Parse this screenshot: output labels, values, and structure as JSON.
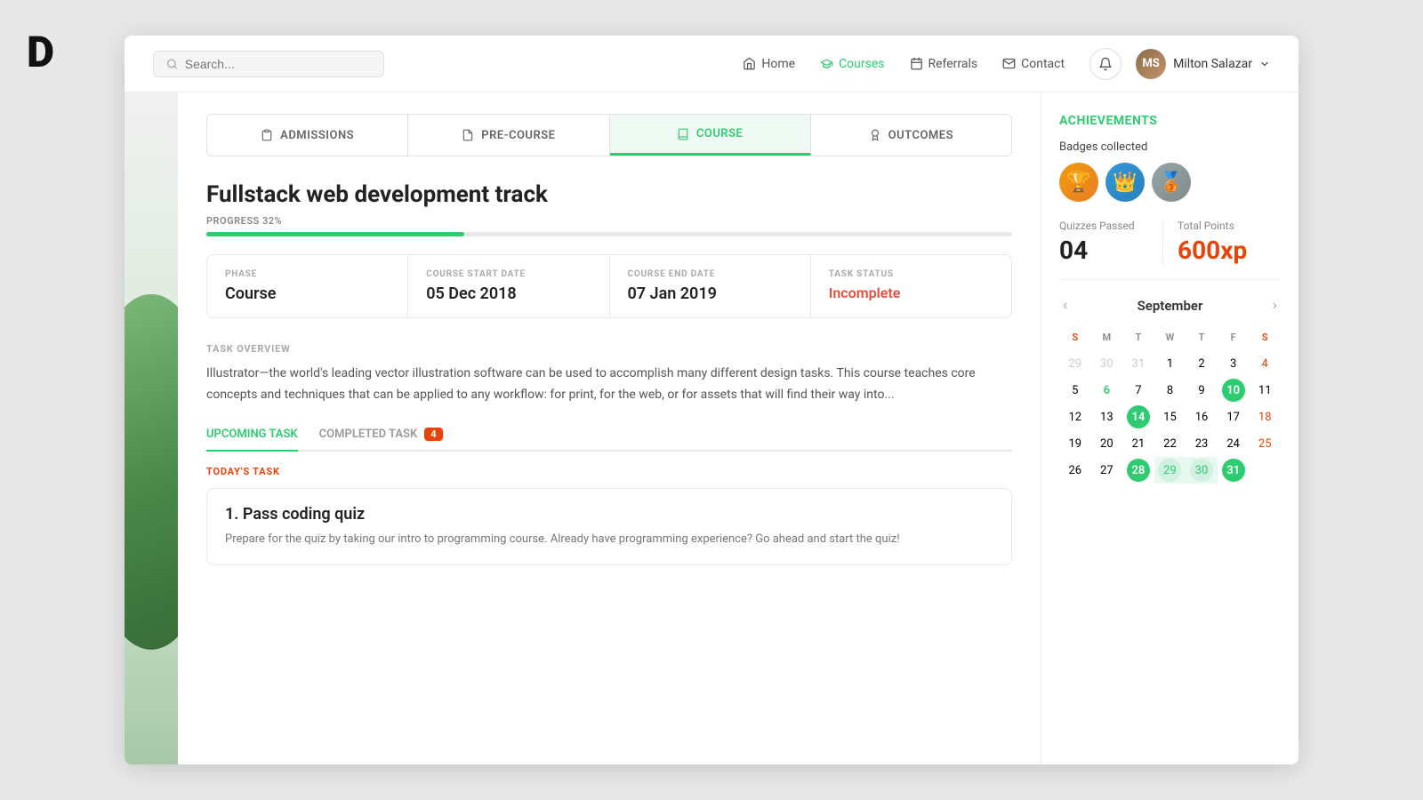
{
  "logo": "D",
  "nav": {
    "search_placeholder": "Search...",
    "links": [
      {
        "label": "Home",
        "icon": "home",
        "active": false
      },
      {
        "label": "Courses",
        "icon": "courses",
        "active": true
      },
      {
        "label": "Referrals",
        "icon": "referrals",
        "active": false
      },
      {
        "label": "Contact",
        "icon": "contact",
        "active": false
      }
    ],
    "user_name": "Milton Salazar",
    "user_initials": "MS"
  },
  "tabs": [
    {
      "label": "ADMISSIONS",
      "icon": "clipboard",
      "active": false
    },
    {
      "label": "PRE-COURSE",
      "icon": "file",
      "active": false
    },
    {
      "label": "COURSE",
      "icon": "book",
      "active": true
    },
    {
      "label": "OUTCOMES",
      "icon": "award",
      "active": false
    }
  ],
  "course": {
    "title": "Fullstack web development track",
    "progress_label": "PROGRESS 32%",
    "progress_value": 32,
    "phase_label": "PHASE",
    "phase_value": "Course",
    "start_label": "COURSE START DATE",
    "start_value": "05 Dec 2018",
    "end_label": "COURSE END DATE",
    "end_value": "07 Jan 2019",
    "status_label": "TASK STATUS",
    "status_value": "Incomplete"
  },
  "task_overview": {
    "label": "TASK OVERVIEW",
    "text": "Illustrator—the world's leading vector illustration software can be used to accomplish many different design tasks. This course teaches core concepts and techniques that can be applied to any workflow: for print, for the web, or for assets that will find their way into..."
  },
  "task_tabs": [
    {
      "label": "UPCOMING TASK",
      "active": true
    },
    {
      "label": "COMPLETED TASK",
      "badge": "4",
      "active": false
    }
  ],
  "today_task": {
    "section_label": "TODAY'S TASK",
    "title": "1. Pass coding quiz",
    "description": "Prepare for the quiz by taking our intro to programming course. Already have programming experience? Go ahead and start the quiz!"
  },
  "achievements": {
    "title": "ACHIEVEMENTS",
    "badges_label": "Badges collected",
    "badges": [
      {
        "emoji": "🏆",
        "type": "gold"
      },
      {
        "emoji": "👑",
        "type": "blue"
      },
      {
        "emoji": "🥉",
        "type": "bronze"
      }
    ],
    "quizzes_label": "Quizzes Passed",
    "quizzes_value": "04",
    "points_label": "Total Points",
    "points_value": "600xp"
  },
  "calendar": {
    "month": "September",
    "prev_label": "‹",
    "next_label": "›",
    "day_headers": [
      "S",
      "M",
      "T",
      "W",
      "T",
      "F",
      "S"
    ],
    "weeks": [
      [
        {
          "day": 29,
          "type": "other"
        },
        {
          "day": 30,
          "type": "other"
        },
        {
          "day": 31,
          "type": "other"
        },
        {
          "day": 1,
          "type": "normal"
        },
        {
          "day": 2,
          "type": "normal"
        },
        {
          "day": 3,
          "type": "normal"
        },
        {
          "day": 4,
          "type": "sat"
        }
      ],
      [
        {
          "day": 5,
          "type": "normal"
        },
        {
          "day": 6,
          "type": "green"
        },
        {
          "day": 7,
          "type": "normal"
        },
        {
          "day": 8,
          "type": "normal"
        },
        {
          "day": 9,
          "type": "normal"
        },
        {
          "day": 10,
          "type": "today"
        },
        {
          "day": 11,
          "type": "normal"
        }
      ],
      [
        {
          "day": 12,
          "type": "normal"
        },
        {
          "day": 13,
          "type": "normal"
        },
        {
          "day": 14,
          "type": "highlighted"
        },
        {
          "day": 15,
          "type": "normal"
        },
        {
          "day": 16,
          "type": "normal"
        },
        {
          "day": 17,
          "type": "normal"
        },
        {
          "day": 18,
          "type": "sat"
        }
      ],
      [
        {
          "day": 19,
          "type": "normal"
        },
        {
          "day": 20,
          "type": "normal"
        },
        {
          "day": 21,
          "type": "normal"
        },
        {
          "day": 22,
          "type": "normal"
        },
        {
          "day": 23,
          "type": "normal"
        },
        {
          "day": 24,
          "type": "normal"
        },
        {
          "day": 25,
          "type": "sat"
        }
      ],
      [
        {
          "day": 26,
          "type": "normal"
        },
        {
          "day": 27,
          "type": "normal"
        },
        {
          "day": 28,
          "type": "range-start"
        },
        {
          "day": 29,
          "type": "range-mid"
        },
        {
          "day": 30,
          "type": "range-mid"
        },
        {
          "day": 31,
          "type": "range-end"
        },
        {
          "day": "",
          "type": "empty"
        }
      ]
    ]
  }
}
